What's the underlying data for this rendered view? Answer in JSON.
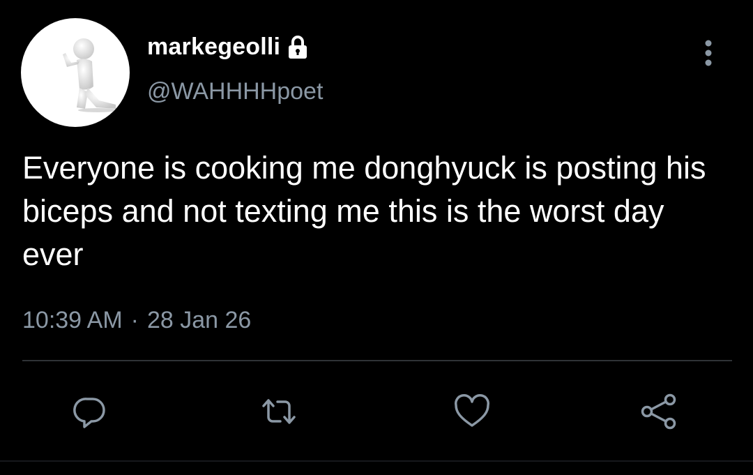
{
  "user": {
    "display_name": "markegeolli",
    "handle": "@WAHHHHpoet",
    "avatar_icon": "praying-figure-avatar",
    "protected_icon": "lock-icon"
  },
  "tweet": {
    "text": "Everyone is cooking me donghyuck is posting his biceps and not texting me this is the worst day ever",
    "time": "10:39 AM",
    "separator": "·",
    "date": "28 Jan 26"
  },
  "actions": {
    "icons": [
      "reply-icon",
      "retweet-icon",
      "like-icon",
      "share-icon"
    ],
    "more_icon": "more-vertical-icon"
  },
  "colors": {
    "background": "#000000",
    "primary_text": "#ffffff",
    "secondary_text": "#8b98a5",
    "divider": "#2f3336"
  }
}
